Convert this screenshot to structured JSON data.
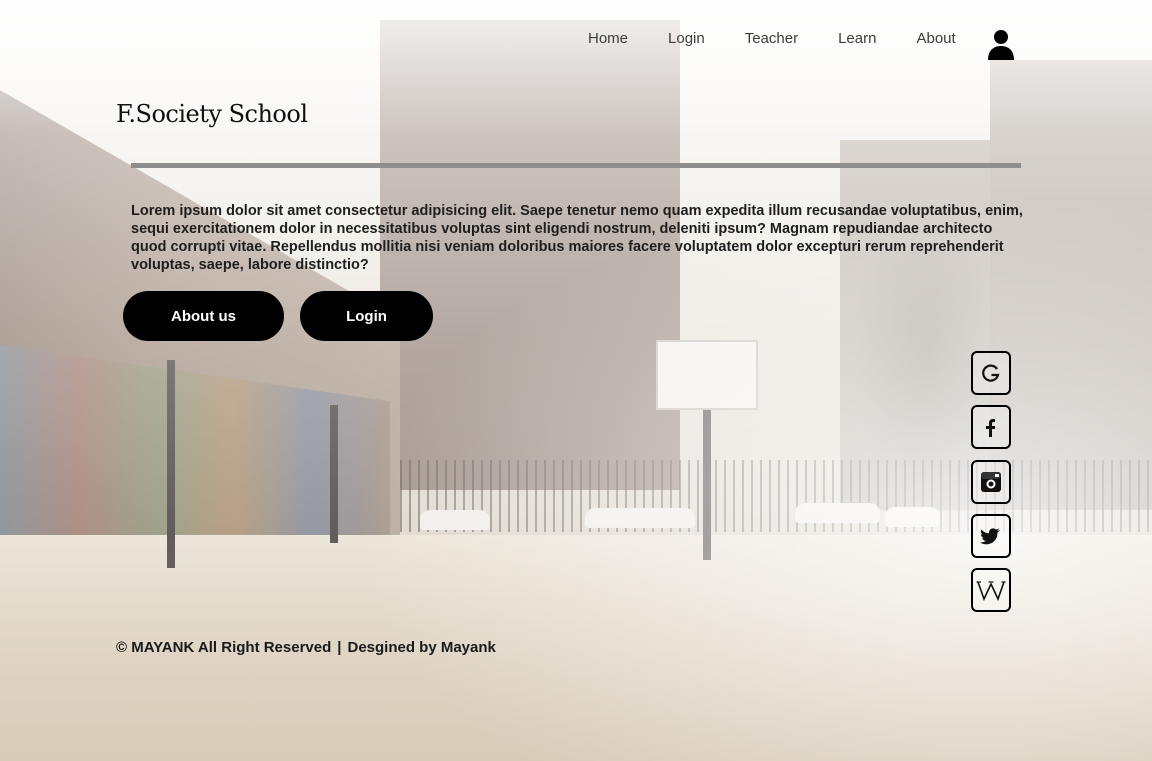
{
  "nav": {
    "items": [
      {
        "label": "Home"
      },
      {
        "label": "Login"
      },
      {
        "label": "Teacher"
      },
      {
        "label": "Learn"
      },
      {
        "label": "About"
      }
    ],
    "user_icon": "user-icon"
  },
  "brand": {
    "title": "F.Society School"
  },
  "intro": {
    "text": "Lorem ipsum dolor sit amet consectetur adipisicing elit. Saepe tenetur nemo quam expedita illum recusandae voluptatibus, enim, sequi exercitationem dolor in necessitatibus voluptas sint eligendi nostrum, deleniti ipsum? Magnam repudiandae architecto quod corrupti vitae. Repellendus mollitia nisi veniam doloribus maiores facere voluptatem dolor excepturi rerum reprehenderit voluptas, saepe, labore distinctio?"
  },
  "buttons": {
    "about_us": "About us",
    "login": "Login"
  },
  "social": [
    {
      "icon": "google-icon"
    },
    {
      "icon": "facebook-icon"
    },
    {
      "icon": "instagram-icon"
    },
    {
      "icon": "twitter-icon"
    },
    {
      "icon": "wikipedia-icon"
    }
  ],
  "footer": {
    "copyright": "© MAYANK All Right Reserved",
    "separator": "|",
    "credit": "Desgined by Mayank"
  },
  "colors": {
    "button_bg": "#000000",
    "button_text": "#ffffff",
    "rule": "#8e8e8e"
  }
}
